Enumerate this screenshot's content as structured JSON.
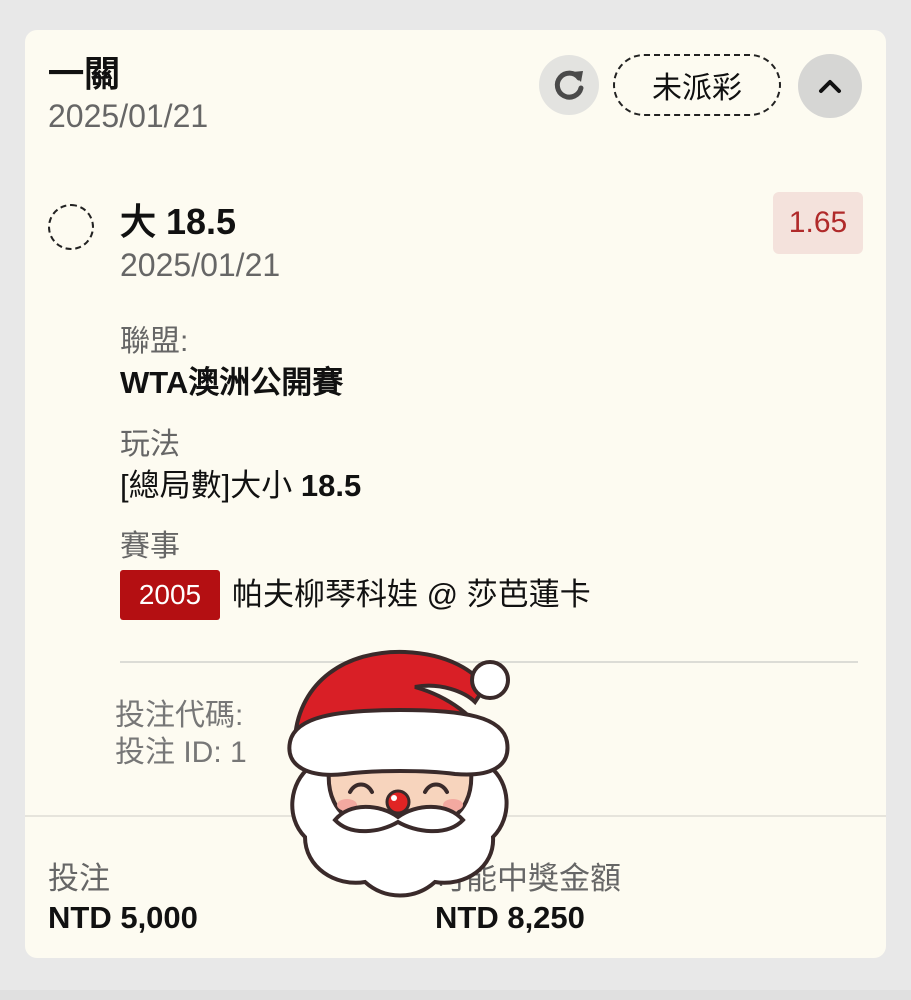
{
  "header": {
    "bet_type": "一關",
    "date": "2025/01/21",
    "status": "未派彩"
  },
  "selection": {
    "name": "大 18.5",
    "date": "2025/01/21",
    "odds": "1.65"
  },
  "details": {
    "league_label": "聯盟:",
    "league_value": "WTA澳洲公開賽",
    "market_label": "玩法",
    "market_value_prefix": "[總局數]大小 ",
    "market_value_line": "18.5",
    "event_label": "賽事",
    "event_id": "2005",
    "event_name": "帕夫柳琴科娃 @ 莎芭蓮卡"
  },
  "meta": {
    "bet_code_label": "投注代碼:",
    "bet_id_label": "投注 ID: 1"
  },
  "footer": {
    "stake_label": "投注",
    "stake_value": "NTD 5,000",
    "payout_label": "可能中獎金額",
    "payout_value": "NTD 8,250"
  },
  "icons": {
    "refresh": "refresh-icon",
    "collapse": "chevron-up-icon",
    "sticker": "santa-sticker"
  },
  "colors": {
    "card_bg": "#fdfbf1",
    "odds_text": "#b02a2a",
    "odds_bg": "#f4e2dc",
    "event_badge": "#b40f12"
  }
}
